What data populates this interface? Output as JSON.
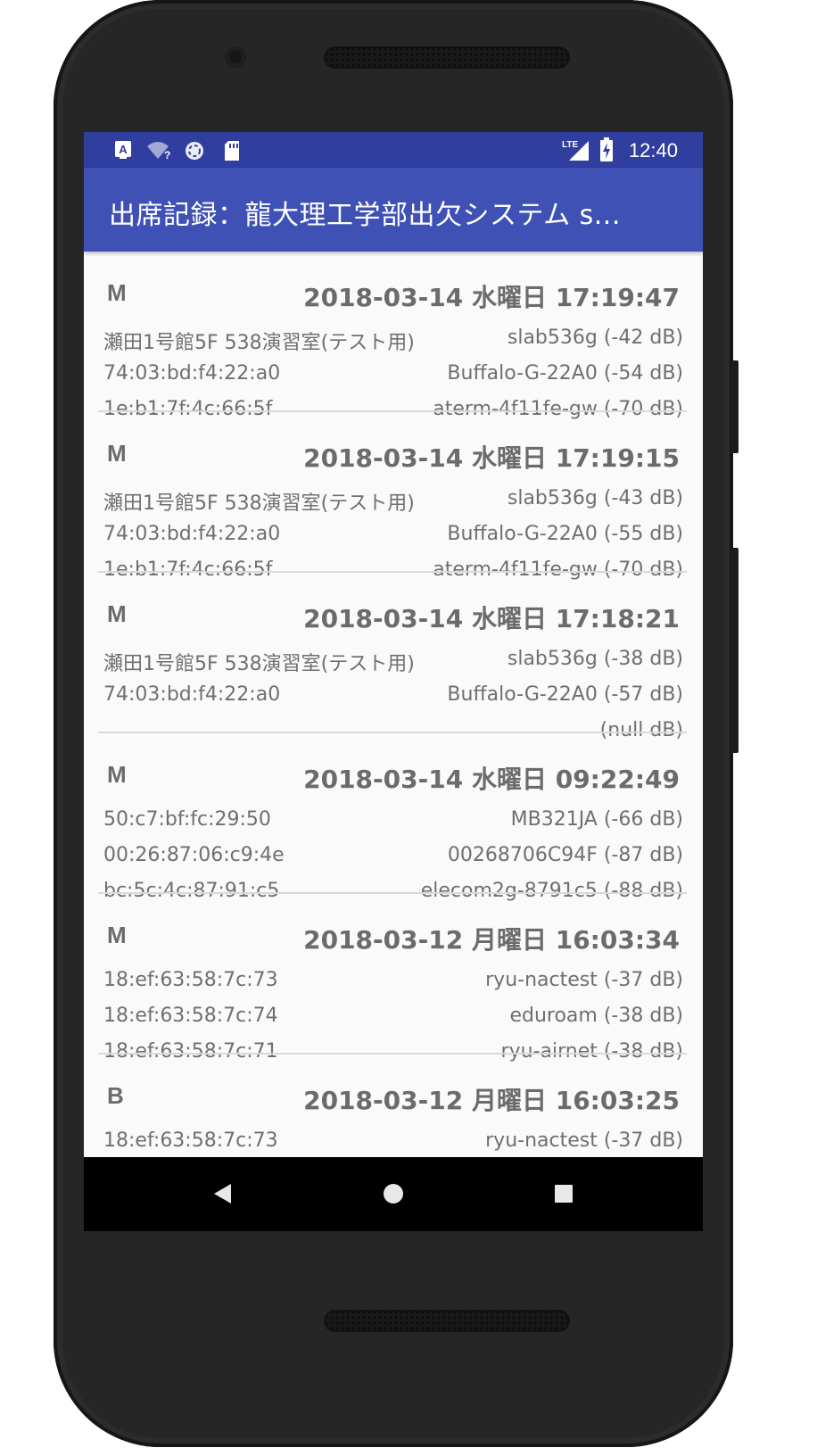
{
  "status_bar": {
    "time": "12:40",
    "network": "LTE",
    "icons": [
      "a-notification-icon",
      "wifi-unknown-icon",
      "sync-icon",
      "sd-card-icon",
      "lte-signal-icon",
      "battery-charging-icon"
    ]
  },
  "app_bar": {
    "title": "出席記録：龍大理工学部出欠システム s..."
  },
  "records": [
    {
      "type": "M",
      "datetime": "2018-03-14 水曜日 17:19:47",
      "rows": [
        {
          "left": "瀬田1号館5F 538演習室(テスト用)",
          "right": "slab536g (-42 dB)"
        },
        {
          "left": "74:03:bd:f4:22:a0",
          "right": "Buffalo-G-22A0 (-54 dB)"
        },
        {
          "left": "1e:b1:7f:4c:66:5f",
          "right": "aterm-4f11fe-gw (-70 dB)"
        }
      ]
    },
    {
      "type": "M",
      "datetime": "2018-03-14 水曜日 17:19:15",
      "rows": [
        {
          "left": "瀬田1号館5F 538演習室(テスト用)",
          "right": "slab536g (-43 dB)"
        },
        {
          "left": "74:03:bd:f4:22:a0",
          "right": "Buffalo-G-22A0 (-55 dB)"
        },
        {
          "left": "1e:b1:7f:4c:66:5f",
          "right": "aterm-4f11fe-gw (-70 dB)"
        }
      ]
    },
    {
      "type": "M",
      "datetime": "2018-03-14 水曜日 17:18:21",
      "rows": [
        {
          "left": "瀬田1号館5F 538演習室(テスト用)",
          "right": "slab536g (-38 dB)"
        },
        {
          "left": "74:03:bd:f4:22:a0",
          "right": "Buffalo-G-22A0 (-57 dB)"
        },
        {
          "left": "",
          "right": "(null dB)"
        }
      ]
    },
    {
      "type": "M",
      "datetime": "2018-03-14 水曜日 09:22:49",
      "rows": [
        {
          "left": "50:c7:bf:fc:29:50",
          "right": "MB321JA (-66 dB)"
        },
        {
          "left": "00:26:87:06:c9:4e",
          "right": "00268706C94F (-87 dB)"
        },
        {
          "left": "bc:5c:4c:87:91:c5",
          "right": "elecom2g-8791c5 (-88 dB)"
        }
      ]
    },
    {
      "type": "M",
      "datetime": "2018-03-12 月曜日 16:03:34",
      "rows": [
        {
          "left": "18:ef:63:58:7c:73",
          "right": "ryu-nactest (-37 dB)"
        },
        {
          "left": "18:ef:63:58:7c:74",
          "right": "eduroam (-38 dB)"
        },
        {
          "left": "18:ef:63:58:7c:71",
          "right": "ryu-airnet (-38 dB)"
        }
      ]
    },
    {
      "type": "B",
      "datetime": "2018-03-12 月曜日 16:03:25",
      "rows": [
        {
          "left": "18:ef:63:58:7c:73",
          "right": "ryu-nactest (-37 dB)"
        }
      ]
    }
  ],
  "nav_bar": {
    "buttons": [
      "back-icon",
      "home-icon",
      "recents-icon"
    ]
  },
  "colors": {
    "status_bar": "#303f9f",
    "app_bar": "#3f51b5",
    "text_primary": "#6b6b6b",
    "background": "#fafafa"
  }
}
